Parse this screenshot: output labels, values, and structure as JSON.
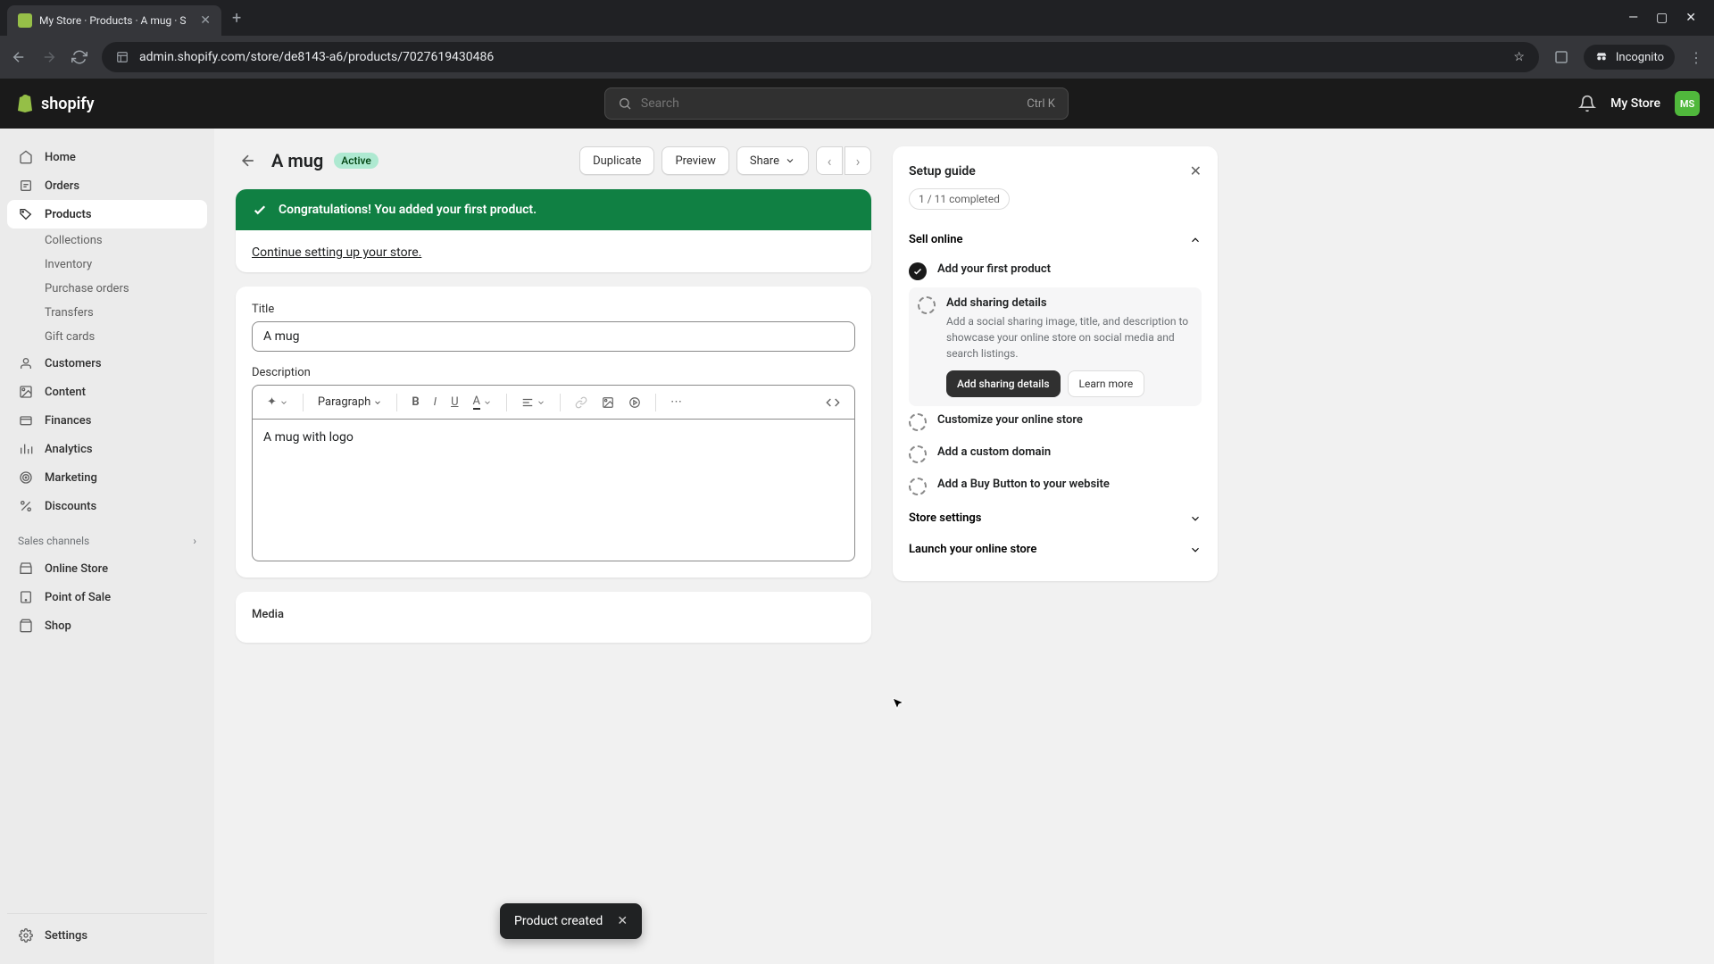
{
  "browser": {
    "tab_title": "My Store · Products · A mug · S",
    "url": "admin.shopify.com/store/de8143-a6/products/7027619430486",
    "incognito": "Incognito"
  },
  "header": {
    "logo_text": "shopify",
    "search_placeholder": "Search",
    "search_kbd": "Ctrl K",
    "store_name": "My Store",
    "avatar_initials": "MS"
  },
  "sidebar": {
    "home": "Home",
    "orders": "Orders",
    "products": "Products",
    "collections": "Collections",
    "inventory": "Inventory",
    "purchase_orders": "Purchase orders",
    "transfers": "Transfers",
    "gift_cards": "Gift cards",
    "customers": "Customers",
    "content": "Content",
    "finances": "Finances",
    "analytics": "Analytics",
    "marketing": "Marketing",
    "discounts": "Discounts",
    "sales_channels": "Sales channels",
    "online_store": "Online Store",
    "point_of_sale": "Point of Sale",
    "shop": "Shop",
    "settings": "Settings"
  },
  "page": {
    "title": "A mug",
    "status": "Active",
    "duplicate": "Duplicate",
    "preview": "Preview",
    "share": "Share"
  },
  "banner": {
    "heading": "Congratulations! You added your first product.",
    "link": "Continue setting up your store."
  },
  "form": {
    "title_label": "Title",
    "title_value": "A mug",
    "description_label": "Description",
    "description_value": "A mug with logo",
    "para_label": "Paragraph",
    "media_label": "Media"
  },
  "setup": {
    "title": "Setup guide",
    "progress": "1 / 11 completed",
    "sell_online": "Sell online",
    "step1": "Add your first product",
    "step2": "Add sharing details",
    "step2_desc": "Add a social sharing image, title, and description to showcase your online store on social media and search listings.",
    "step2_btn": "Add sharing details",
    "step2_learn": "Learn more",
    "step3": "Customize your online store",
    "step4": "Add a custom domain",
    "step5": "Add a Buy Button to your website",
    "store_settings": "Store settings",
    "launch": "Launch your online store"
  },
  "toast": {
    "message": "Product created"
  }
}
